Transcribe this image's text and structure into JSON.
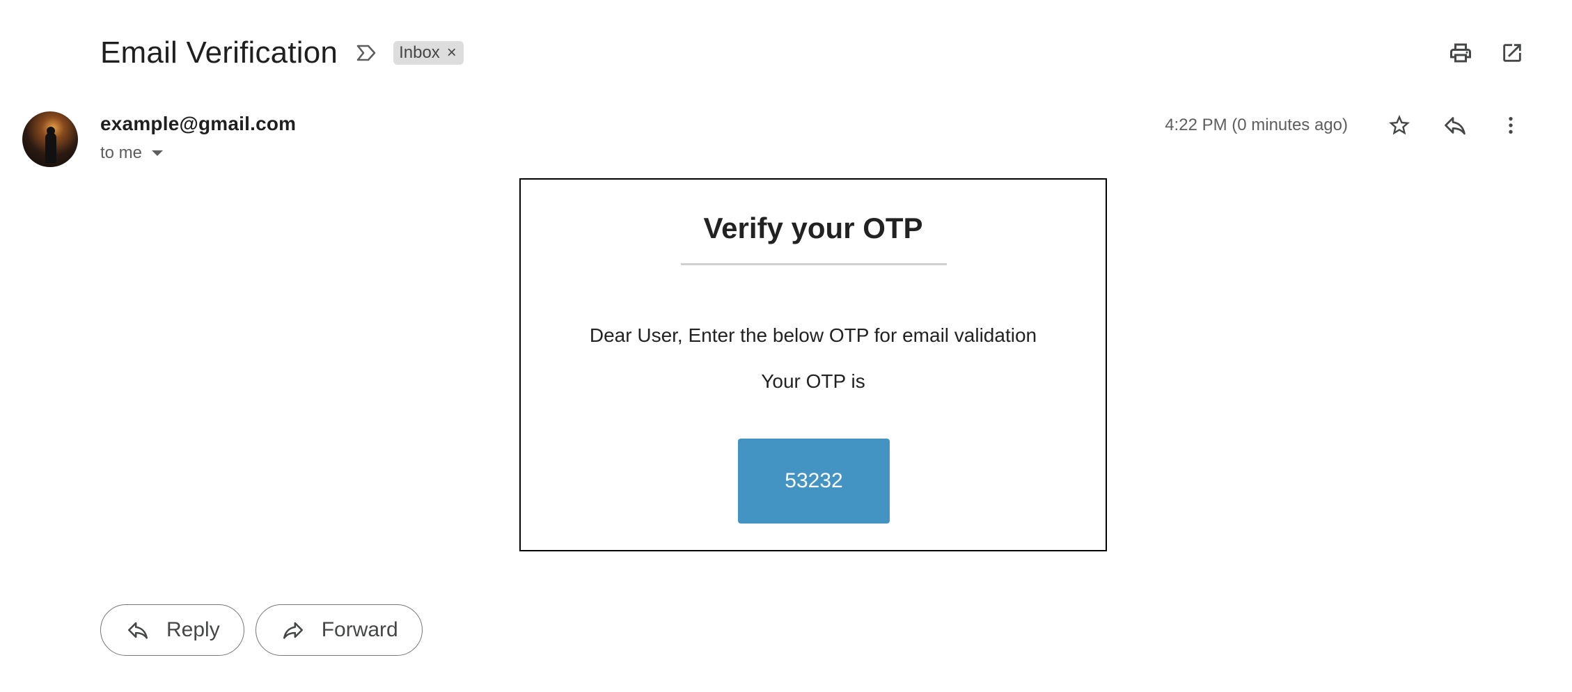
{
  "email": {
    "subject": "Email Verification",
    "label": "Inbox",
    "label_remove": "×",
    "sender": "example@gmail.com",
    "recipient": "to me",
    "timestamp": "4:22 PM (0 minutes ago)"
  },
  "header_actions": {
    "print_icon": "print-icon",
    "open_new_window_icon": "open-in-new-icon"
  },
  "message_actions": {
    "star_icon": "star-outline-icon",
    "reply_icon": "reply-icon",
    "more_icon": "more-vert-icon"
  },
  "body": {
    "title": "Verify your OTP",
    "message": "Dear User, Enter the below OTP for email validation",
    "otp_label": "Your OTP is",
    "otp_code": "53232",
    "otp_bg_color": "#4393c3"
  },
  "footer": {
    "reply_label": "Reply",
    "forward_label": "Forward"
  }
}
